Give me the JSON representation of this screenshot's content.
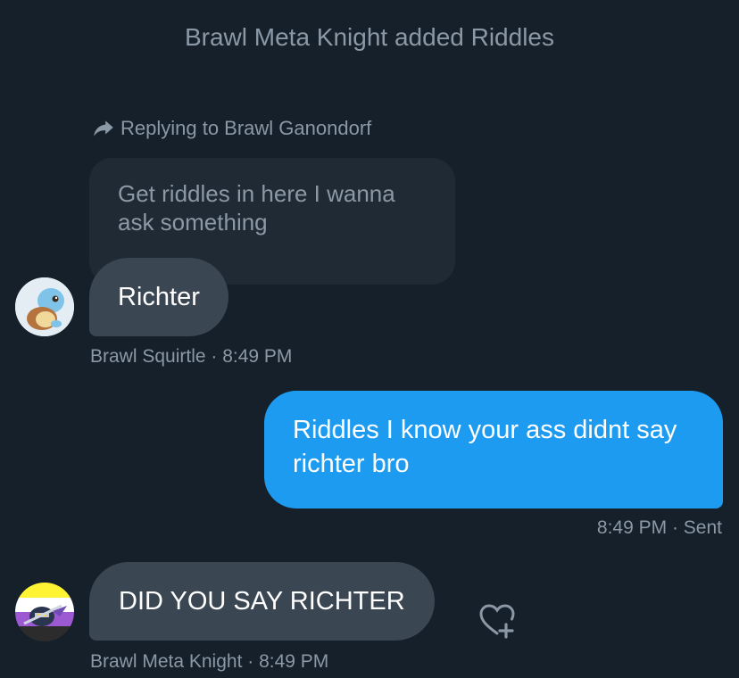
{
  "system": {
    "text": "Brawl Meta Knight added Riddles"
  },
  "reply": {
    "label": "Replying to Brawl Ganondorf",
    "quoted_text": "Get riddles in here I wanna ask something"
  },
  "messages": [
    {
      "text": "Richter",
      "sender": "Brawl Squirtle",
      "time": "8:49 PM",
      "meta": "Brawl Squirtle · 8:49 PM"
    },
    {
      "text": "Riddles I know your ass didnt say richter bro",
      "time": "8:49 PM",
      "status": "Sent",
      "meta": "8:49 PM · Sent"
    },
    {
      "text": "DID YOU SAY RICHTER",
      "sender": "Brawl Meta Knight",
      "time": "8:49 PM",
      "meta": "Brawl Meta Knight · 8:49 PM"
    }
  ],
  "colors": {
    "background": "#15202b",
    "incoming_bubble": "#3a4753",
    "outgoing_bubble": "#1d9bf0",
    "muted_text": "#8b98a5"
  },
  "icons": {
    "reply": "reply-arrow-icon",
    "react": "heart-plus-icon"
  }
}
